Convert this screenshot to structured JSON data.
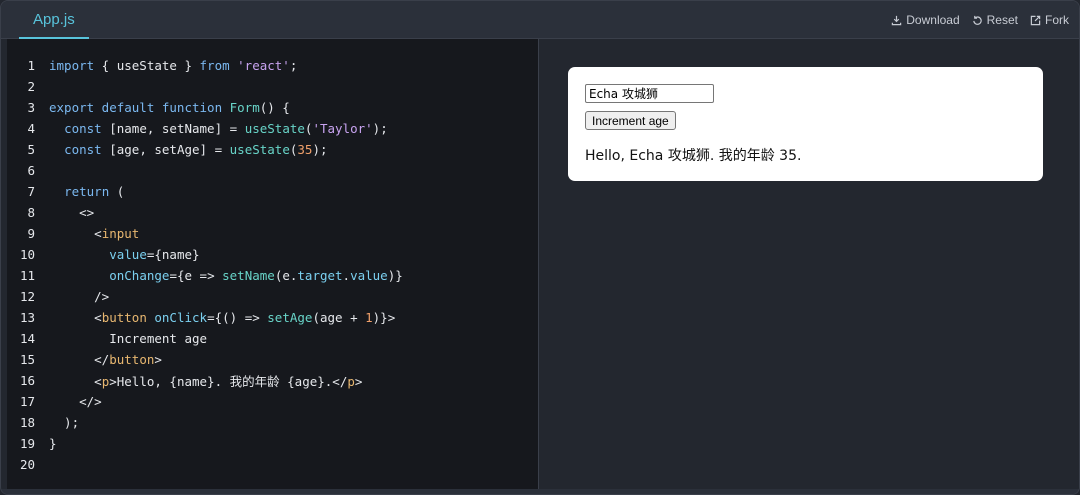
{
  "tab": {
    "label": "App.js"
  },
  "toolbar": {
    "download_label": "Download",
    "reset_label": "Reset",
    "fork_label": "Fork"
  },
  "code": {
    "line_numbers": [
      "1",
      "2",
      "3",
      "4",
      "5",
      "6",
      "7",
      "8",
      "9",
      "10",
      "11",
      "12",
      "13",
      "14",
      "15",
      "16",
      "17",
      "18",
      "19",
      "20"
    ]
  },
  "preview": {
    "input_value": "Echa 攻城狮",
    "button_label": "Increment age",
    "greeting": "Hello, Echa 攻城狮. 我的年龄 35."
  }
}
